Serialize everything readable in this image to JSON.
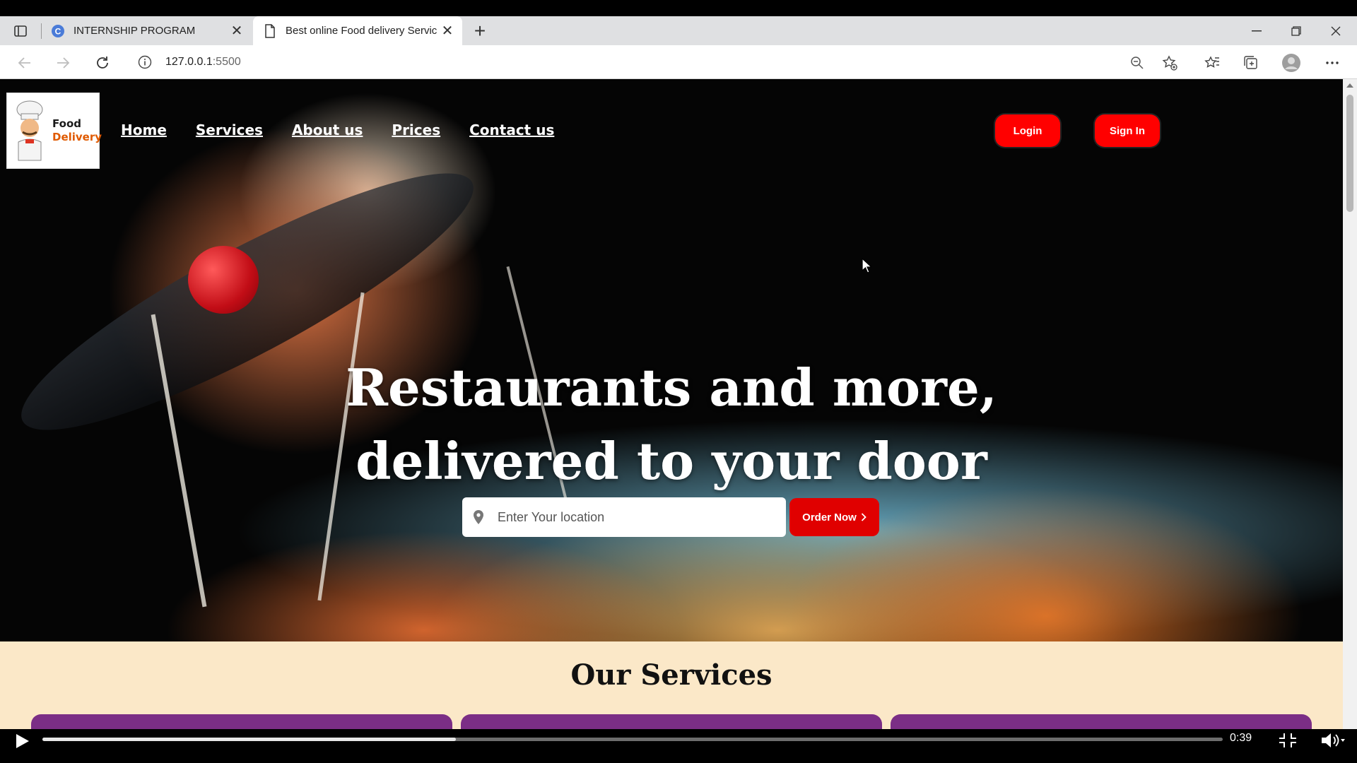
{
  "browser": {
    "tabs": [
      {
        "label": "INTERNSHIP PROGRAM",
        "active": false
      },
      {
        "label": "Best online Food delivery Servic",
        "active": true
      }
    ],
    "url_host": "127.0.0.1",
    "url_port": ":5500"
  },
  "site": {
    "logo": {
      "line1": "Food",
      "line2": "Delivery"
    },
    "nav": [
      "Home",
      "Services",
      "About us",
      "Prices",
      "Contact us"
    ],
    "login_label": "Login",
    "signin_label": "Sign In",
    "headline_line1": "Restaurants and more,",
    "headline_line2": "delivered to your door",
    "search_placeholder": "Enter Your location",
    "order_label": "Order Now",
    "services_title": "Our Services"
  },
  "video": {
    "time": "0:39",
    "progress_percent": 35
  },
  "colors": {
    "accent_red": "#ff0000",
    "services_bg": "#fbe8c8",
    "card_purple": "#7b2e86"
  }
}
